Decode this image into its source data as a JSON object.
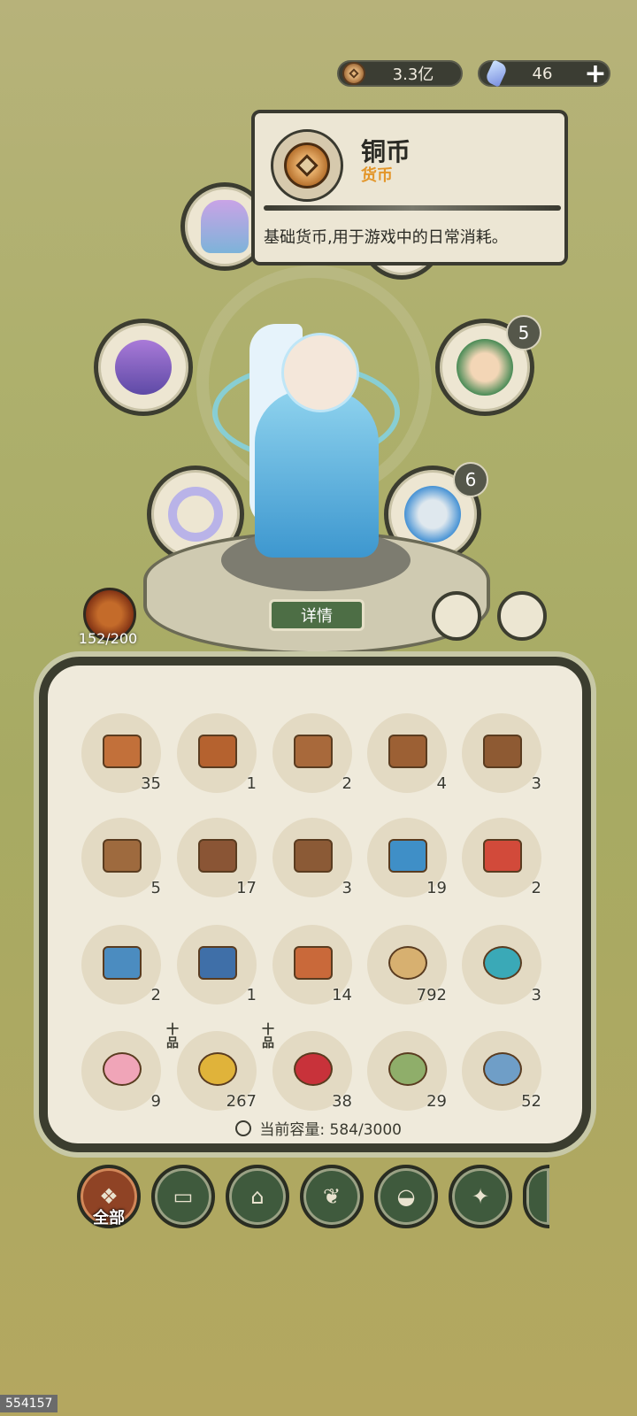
{
  "currency": {
    "coins": "3.3亿",
    "gems": "46",
    "plus": "+"
  },
  "tooltip": {
    "title": "铜币",
    "subtitle": "货币",
    "description": "基础货币,用于游戏中的日常消耗。"
  },
  "equipment": {
    "right_top_badge": "5",
    "right_bottom_badge": "6"
  },
  "detail_button": "详情",
  "pet_count": "152/200",
  "inventory": {
    "items": [
      {
        "count": "35",
        "color": "#c2703a"
      },
      {
        "count": "1",
        "color": "#b5622f"
      },
      {
        "count": "2",
        "color": "#a8693b"
      },
      {
        "count": "4",
        "color": "#9c6034"
      },
      {
        "count": "3",
        "color": "#8e5a33"
      },
      {
        "count": "5",
        "color": "#9e6a3e"
      },
      {
        "count": "17",
        "color": "#8a5535"
      },
      {
        "count": "3",
        "color": "#8b5a36"
      },
      {
        "count": "19",
        "color": "#3f8fc7"
      },
      {
        "count": "2",
        "color": "#d24a3a"
      },
      {
        "count": "2",
        "color": "#4b8cc0"
      },
      {
        "count": "1",
        "color": "#3f6fa8"
      },
      {
        "count": "14",
        "color": "#c9693a"
      },
      {
        "count": "792",
        "color": "#d7b070"
      },
      {
        "count": "3",
        "color": "#3aa9b7"
      },
      {
        "count": "9",
        "color": "#f0a5b8"
      },
      {
        "count": "267",
        "color": "#e0b33a",
        "grade": "十品"
      },
      {
        "count": "38",
        "color": "#c8323a",
        "grade": "十品"
      },
      {
        "count": "29",
        "color": "#8fae6a"
      },
      {
        "count": "52",
        "color": "#6f9ec7"
      }
    ],
    "capacity_label": "当前容量:",
    "capacity_value": "584/3000"
  },
  "tabs": {
    "all": "全部"
  },
  "uid": "554157"
}
